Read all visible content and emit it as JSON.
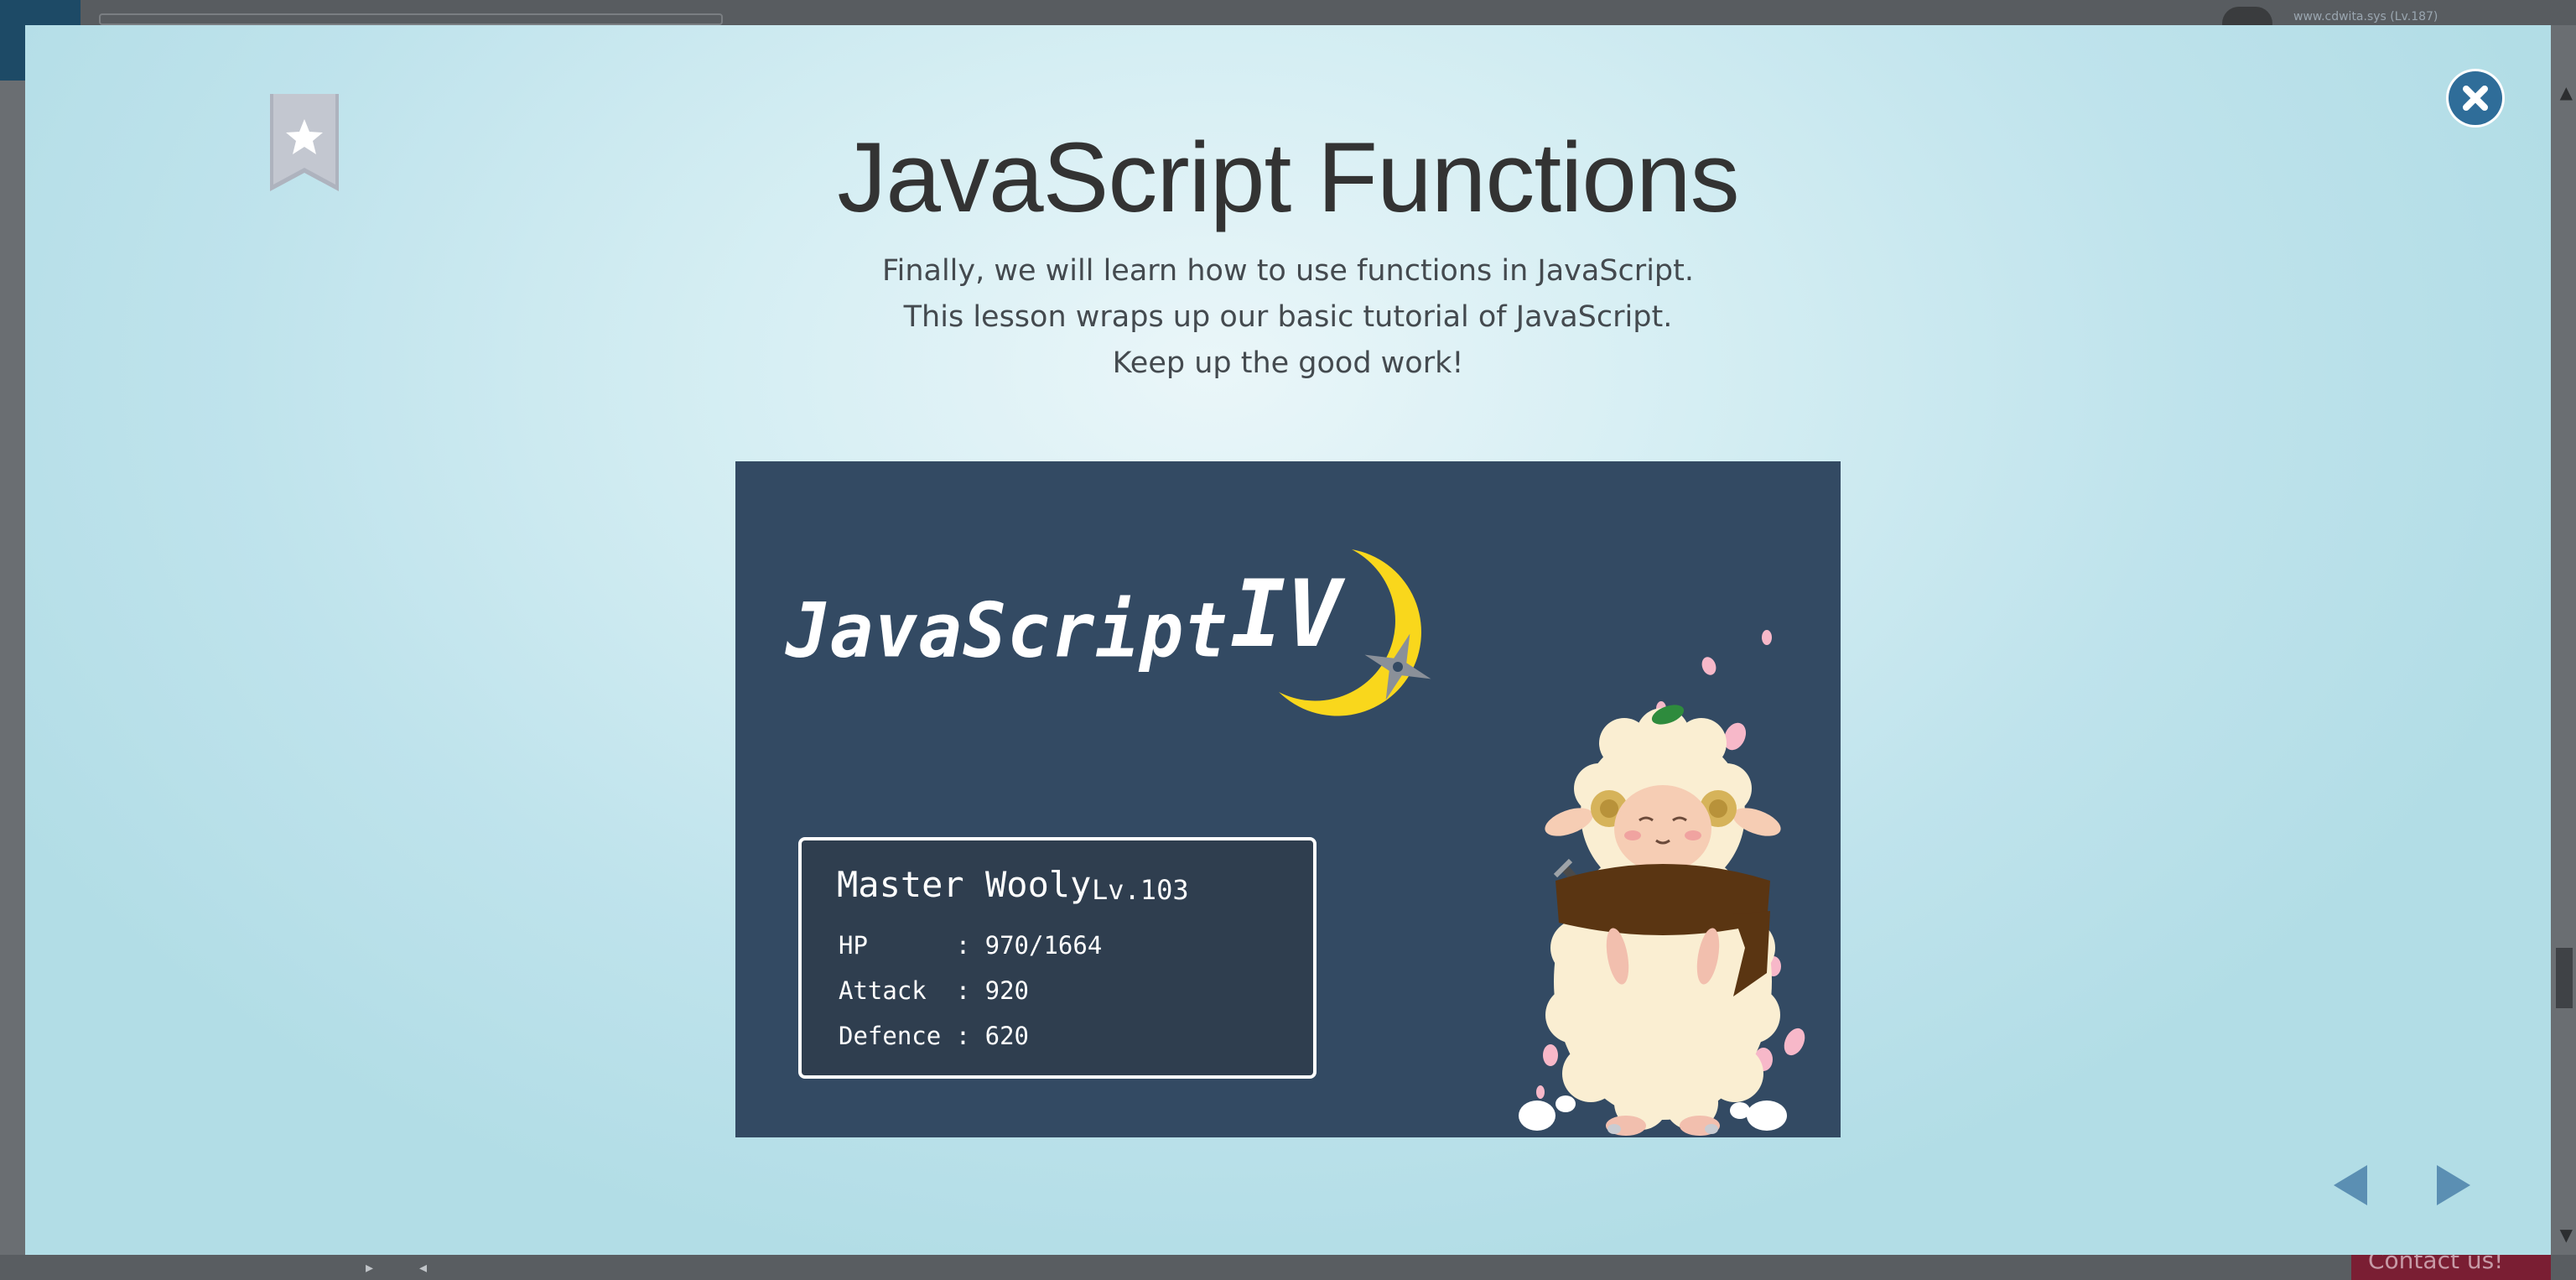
{
  "background": {
    "user_text": "www.cdwita.sys (Lv.187)",
    "contact_label": "Contact us!"
  },
  "modal": {
    "title": "JavaScript Functions",
    "description": [
      "Finally, we will learn how to use functions in JavaScript.",
      "This lesson wraps up our basic tutorial of JavaScript.",
      "Keep up the good work!"
    ],
    "icons": {
      "bookmark": "bookmark-star-icon",
      "close": "close-icon",
      "prev": "arrow-left-icon",
      "next": "arrow-right-icon"
    },
    "colors": {
      "close_button": "#2f6d99",
      "nav_arrow": "#5b8fb3",
      "bookmark": "#c3c7d0"
    }
  },
  "lesson_image": {
    "logo_text": "JavaScript",
    "logo_numeral": "IV",
    "character_name": "Master Wooly",
    "character_level": "Lv.103",
    "stats": [
      {
        "label": "HP      ",
        "value": "970/1664"
      },
      {
        "label": "Attack  ",
        "value": "920"
      },
      {
        "label": "Defence ",
        "value": "620"
      }
    ],
    "colors": {
      "panel_background": "#334a63",
      "moon": "#f9d71c"
    }
  }
}
